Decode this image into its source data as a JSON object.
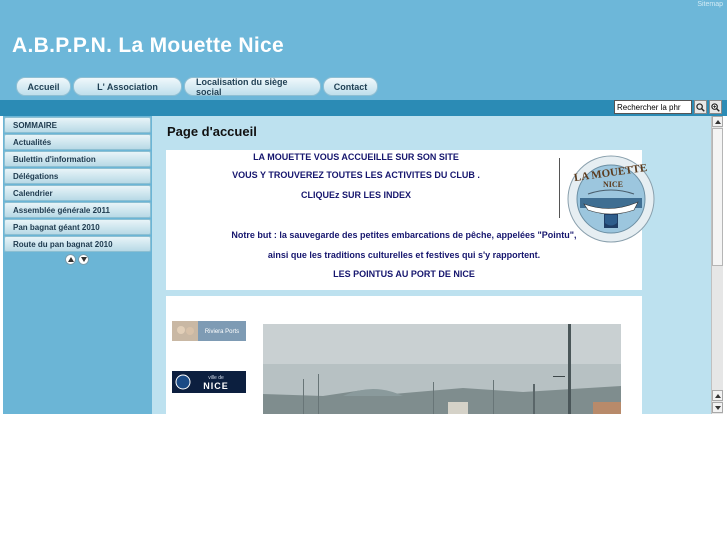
{
  "header": {
    "sitemap_label": "Sitemap",
    "site_title": "A.B.P.P.N. La Mouette Nice"
  },
  "nav": {
    "items": [
      {
        "label": "Accueil"
      },
      {
        "label": "L' Association"
      },
      {
        "label": "Localisation du siège social"
      },
      {
        "label": "Contact"
      }
    ]
  },
  "search": {
    "value": "Rechercher la phr"
  },
  "sidebar": {
    "items": [
      {
        "label": "SOMMAIRE"
      },
      {
        "label": "Actualités"
      },
      {
        "label": "Bulettin d'information"
      },
      {
        "label": "Délégations"
      },
      {
        "label": "Calendrier"
      },
      {
        "label": "Assemblée générale 2011"
      },
      {
        "label": "Pan bagnat géant 2010"
      },
      {
        "label": "Route du pan bagnat 2010"
      }
    ]
  },
  "main": {
    "page_title": "Page d'accueil",
    "welcome_lines": [
      "LA MOUETTE VOUS ACCUEILLE SUR SON SITE",
      "VOUS Y TROUVEREZ TOUTES LES ACTIVITES DU CLUB .",
      "CLIQUEz SUR LES INDEX"
    ],
    "goal_lines": [
      "Notre but :  la sauvegarde des petites embarcations de pêche, appelées \"Pointu\",",
      "ainsi que les traditions culturelles et festives qui s'y rapportent.",
      "LES POINTUS AU PORT DE NICE"
    ],
    "logo": {
      "text": "LA MOUETTE",
      "subtext": "NICE"
    },
    "ads": {
      "riviera": "Riviera Ports",
      "nice_prefix": "ville de",
      "nice": "NICE"
    }
  },
  "colors": {
    "header_bg": "#6db7d9",
    "strip_bg": "#2b8bb5",
    "main_bg": "#bde1ef",
    "text_navy": "#16166e"
  }
}
